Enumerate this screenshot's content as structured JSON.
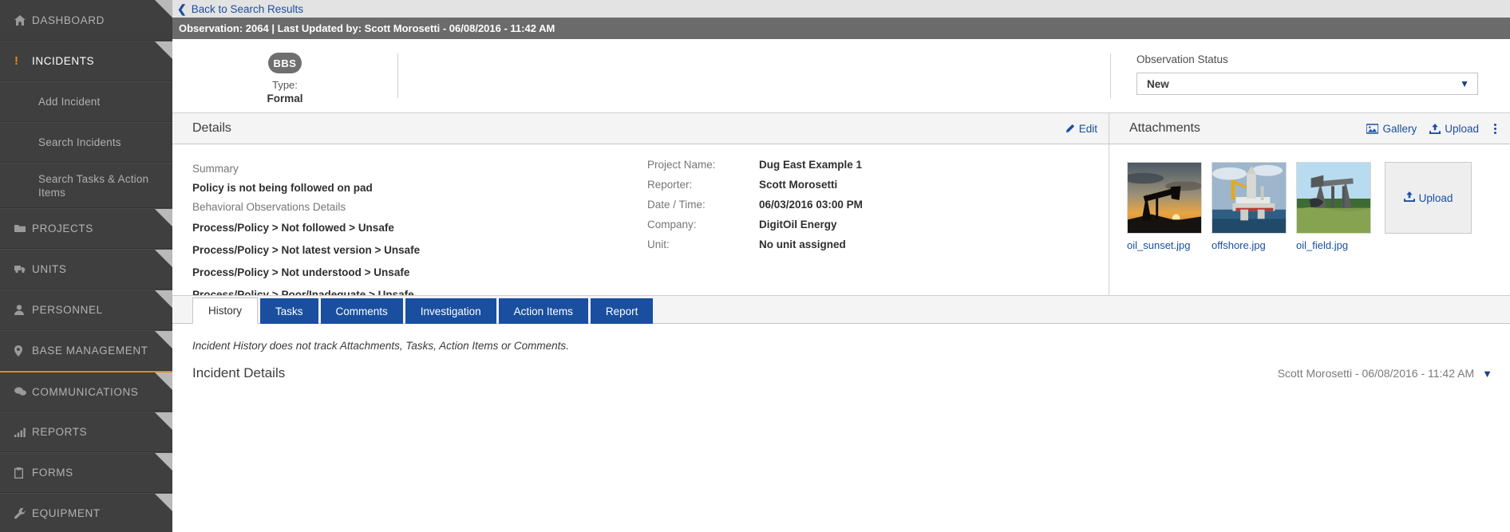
{
  "sidebar": {
    "items": [
      {
        "label": "DASHBOARD",
        "icon": "home-icon",
        "type": "top",
        "active": false
      },
      {
        "label": "INCIDENTS",
        "icon": "exclamation-icon",
        "type": "top",
        "active": true
      },
      {
        "label": "Add Incident",
        "icon": "",
        "type": "sub",
        "active": false
      },
      {
        "label": "Search Incidents",
        "icon": "",
        "type": "sub",
        "active": false
      },
      {
        "label": "Search Tasks & Action Items",
        "icon": "",
        "type": "sub",
        "active": false
      },
      {
        "label": "PROJECTS",
        "icon": "folder-icon",
        "type": "top",
        "active": false
      },
      {
        "label": "UNITS",
        "icon": "truck-icon",
        "type": "top",
        "active": false
      },
      {
        "label": "PERSONNEL",
        "icon": "person-icon",
        "type": "top",
        "active": false
      },
      {
        "label": "BASE MANAGEMENT",
        "icon": "map-pin-icon",
        "type": "top",
        "active": false
      },
      {
        "label": "COMMUNICATIONS",
        "icon": "chat-icon",
        "type": "top",
        "active": false
      },
      {
        "label": "REPORTS",
        "icon": "bar-chart-icon",
        "type": "top",
        "active": false
      },
      {
        "label": "FORMS",
        "icon": "clipboard-icon",
        "type": "top",
        "active": false
      },
      {
        "label": "EQUIPMENT",
        "icon": "wrench-icon",
        "type": "top",
        "active": false
      }
    ]
  },
  "topbar": {
    "back_label": "Back to Search Results",
    "observation_bar": "Observation: 2064 | Last Updated by: Scott Morosetti - 06/08/2016 - 11:42 AM"
  },
  "type_strip": {
    "badge": "BBS",
    "type_label": "Type:",
    "type_value": "Formal",
    "status_label": "Observation Status",
    "status_value": "New"
  },
  "details": {
    "title": "Details",
    "edit_label": "Edit",
    "summary_label": "Summary",
    "summary_value": "Policy is not being followed on pad",
    "observations_label": "Behavioral Observations Details",
    "observations": [
      "Process/Policy > Not followed > Unsafe",
      "Process/Policy > Not latest version > Unsafe",
      "Process/Policy > Not understood > Unsafe",
      "Process/Policy > Poor/Inadequate > Unsafe"
    ],
    "fields": [
      {
        "key": "Project Name:",
        "value": "Dug East Example 1"
      },
      {
        "key": "Reporter:",
        "value": "Scott Morosetti"
      },
      {
        "key": "Date / Time:",
        "value": "06/03/2016 03:00 PM"
      },
      {
        "key": "Company:",
        "value": "DigitOil Energy"
      },
      {
        "key": "Unit:",
        "value": "No unit assigned"
      }
    ]
  },
  "attachments": {
    "title": "Attachments",
    "gallery_label": "Gallery",
    "upload_label": "Upload",
    "upload_box_label": "Upload",
    "items": [
      {
        "name": "oil_sunset.jpg",
        "art": "pumpjack-sunset"
      },
      {
        "name": "offshore.jpg",
        "art": "offshore-rig"
      },
      {
        "name": "oil_field.jpg",
        "art": "pumpjack-field"
      }
    ]
  },
  "tabs": [
    {
      "label": "History",
      "active": true
    },
    {
      "label": "Tasks",
      "active": false
    },
    {
      "label": "Comments",
      "active": false
    },
    {
      "label": "Investigation",
      "active": false
    },
    {
      "label": "Action Items",
      "active": false
    },
    {
      "label": "Report",
      "active": false
    }
  ],
  "history": {
    "note": "Incident History does not track Attachments, Tasks, Action Items or Comments.",
    "entry_title": "Incident Details",
    "entry_meta": "Scott Morosetti - 06/08/2016 - 11:42 AM"
  },
  "colors": {
    "sidebar_bg": "#3f3f3f",
    "accent_orange": "#e8861e",
    "link_blue": "#1a4fa0",
    "tab_blue": "#1a4fa0",
    "bar_gray": "#6b6b6b"
  }
}
